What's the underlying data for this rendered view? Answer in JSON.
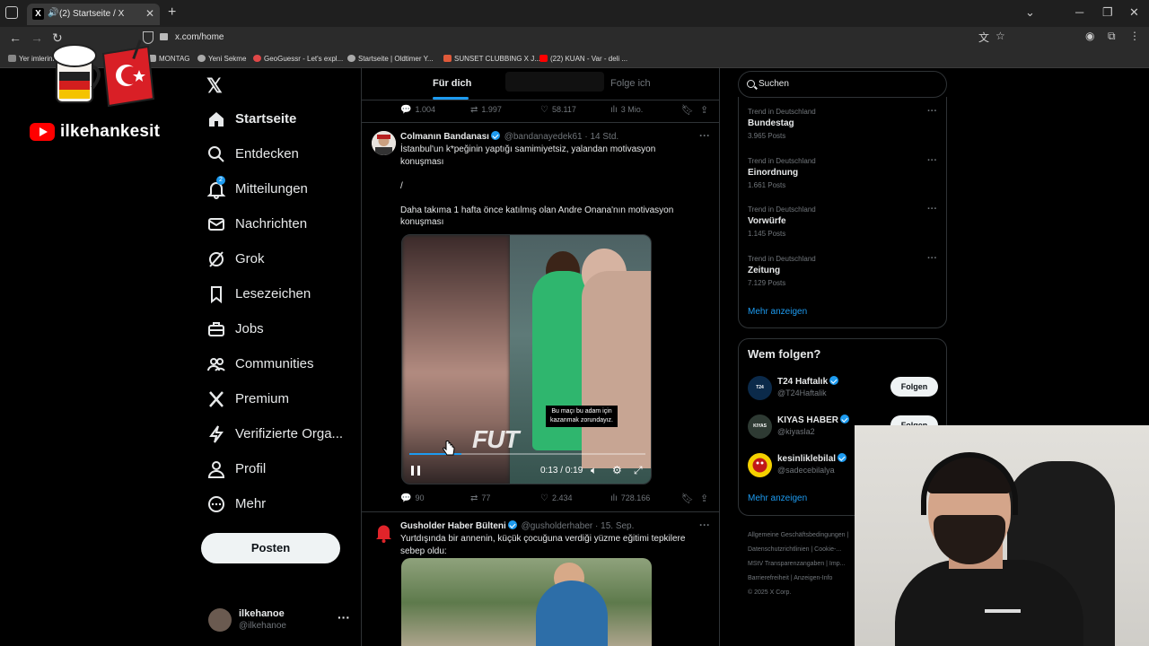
{
  "browser": {
    "tab_title": "(2) Startseite / X",
    "tab_close": "✕",
    "new_tab": "+",
    "url": "x.com/home",
    "bookmarks": [
      {
        "label": "Yer imlerini",
        "color": "#888"
      },
      {
        "label": "MONTAG",
        "color": "#aaa"
      },
      {
        "label": "Yeni Sekme",
        "color": "#aaa"
      },
      {
        "label": "GeoGuessr - Let's expl...",
        "color": "#e04848"
      },
      {
        "label": "Startseite | Oldtimer Y...",
        "color": "#aaa"
      },
      {
        "label": "SUNSET CLUBBING X J...",
        "color": "#e05a3a"
      },
      {
        "label": "(22) KUAN - Var - deli ...",
        "color": "#ff0000"
      }
    ]
  },
  "overlay": {
    "channel_name": "ilkehankesit"
  },
  "nav": {
    "items": [
      {
        "label": "Startseite",
        "icon": "home-icon"
      },
      {
        "label": "Entdecken",
        "icon": "search-icon"
      },
      {
        "label": "Mitteilungen",
        "icon": "bell-icon",
        "badge": "2"
      },
      {
        "label": "Nachrichten",
        "icon": "mail-icon"
      },
      {
        "label": "Grok",
        "icon": "grok-icon"
      },
      {
        "label": "Lesezeichen",
        "icon": "bookmark-icon"
      },
      {
        "label": "Jobs",
        "icon": "briefcase-icon"
      },
      {
        "label": "Communities",
        "icon": "people-icon"
      },
      {
        "label": "Premium",
        "icon": "x-icon"
      },
      {
        "label": "Verifizierte Orga...",
        "icon": "lightning-icon"
      },
      {
        "label": "Profil",
        "icon": "person-icon"
      },
      {
        "label": "Mehr",
        "icon": "more-circle-icon"
      }
    ],
    "post_button": "Posten",
    "account": {
      "name": "ilkehanoe",
      "handle": "@ilkehanoe"
    }
  },
  "feed": {
    "tabs": [
      {
        "label": "Für dich",
        "active": true
      },
      {
        "label": "Folge ich",
        "active": false
      }
    ],
    "top_stats": {
      "replies": "1.004",
      "reposts": "1.997",
      "likes": "58.117",
      "views": "3 Mio."
    },
    "post1": {
      "name": "Colmanın Bandanası",
      "handle": "@bandanayedek61",
      "time": "14 Std.",
      "line1": "İstanbul'un k*peğinin yaptığı samimiyetsiz, yalandan motivasyon",
      "line2": "konuşması",
      "line3": "/",
      "line4": "Daha takıma 1 hafta önce katılmış olan Andre Onana'nın motivasyon",
      "line5": "konuşması",
      "video_caption": "Bu maçı bu adam için kazanmak zorundayız.",
      "video_watermark": "FUT",
      "video_time": "0:13 / 0:19",
      "video_progress": 0.22,
      "stats": {
        "replies": "90",
        "reposts": "77",
        "likes": "2.434",
        "views": "728.166"
      }
    },
    "post2": {
      "name": "Gusholder Haber Bülteni",
      "handle": "@gusholderhaber",
      "time": "15. Sep.",
      "line1": "Yurtdışında bir annenin, küçük çocuğuna verdiği yüzme eğitimi tepkilere",
      "line2": "sebep oldu:"
    }
  },
  "right": {
    "search_placeholder": "Suchen",
    "trends": [
      {
        "context": "Trend in Deutschland",
        "name": "Bundestag",
        "posts": "3.965 Posts"
      },
      {
        "context": "Trend in Deutschland",
        "name": "Einordnung",
        "posts": "1.661 Posts"
      },
      {
        "context": "Trend in Deutschland",
        "name": "Vorwürfe",
        "posts": "1.145 Posts"
      },
      {
        "context": "Trend in Deutschland",
        "name": "Zeitung",
        "posts": "7.129 Posts"
      }
    ],
    "trends_more": "Mehr anzeigen",
    "who_to_follow": {
      "title": "Wem folgen?",
      "items": [
        {
          "name": "T24 Haftalık",
          "handle": "@T24Haftalik",
          "avatar_text": "T24 HAFTALIK",
          "avatar_color": "#0b2a4a"
        },
        {
          "name": "KIYAS HABER",
          "handle": "@kiyasla2",
          "avatar_text": "KIYAS HABER",
          "avatar_color": "#2e3a33"
        },
        {
          "name": "kesinliklebilal",
          "handle": "@sadecebilalya",
          "avatar_text": "",
          "avatar_color": "#f5d000"
        }
      ],
      "follow_label": "Folgen",
      "more": "Mehr anzeigen"
    },
    "footer": {
      "l1": "Allgemeine Geschäftsbedingungen |",
      "l2": "Datenschutzrichtlinien | Cookie-...",
      "l3": "MStV Transparenzangaben | Imp...",
      "l4": "Barrierefreiheit | Anzeigen-Info",
      "l5": "© 2025 X Corp."
    }
  }
}
